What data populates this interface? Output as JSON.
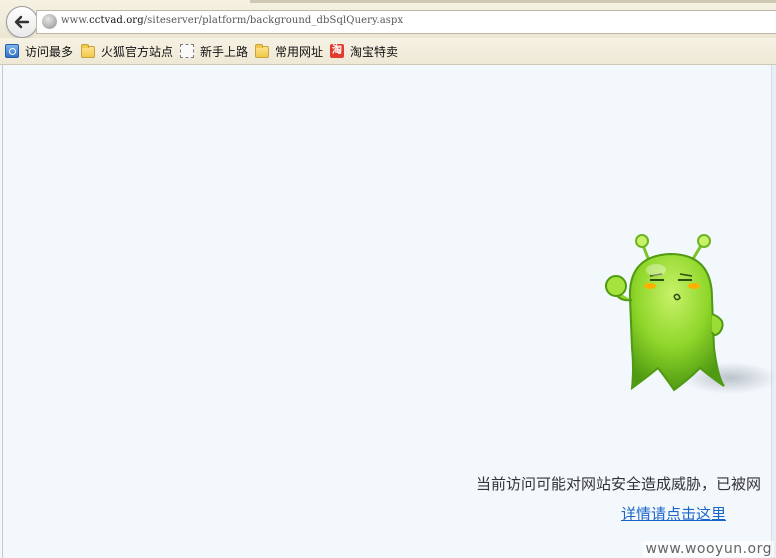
{
  "browser": {
    "url_prefix": "www.",
    "url_domain": "cctvad.org",
    "url_path": "/siteserver/platform/background_dbSqlQuery.aspx"
  },
  "bookmarks": [
    {
      "label": "访问最多",
      "icon": "search-icon"
    },
    {
      "label": "火狐官方站点",
      "icon": "folder-icon"
    },
    {
      "label": "新手上路",
      "icon": "dotted-page-icon"
    },
    {
      "label": "常用网址",
      "icon": "folder-icon"
    },
    {
      "label": "淘宝特卖",
      "icon": "taobao-icon",
      "icon_text": "淘"
    }
  ],
  "page": {
    "warning_text": "当前访问可能对网站安全造成威胁，已被网",
    "details_link": "详情请点击这里"
  },
  "watermark": "www.wooyun.org",
  "colors": {
    "background": "#f3f8fd",
    "link": "#1a63c9",
    "mascot_green": "#7ed321"
  }
}
